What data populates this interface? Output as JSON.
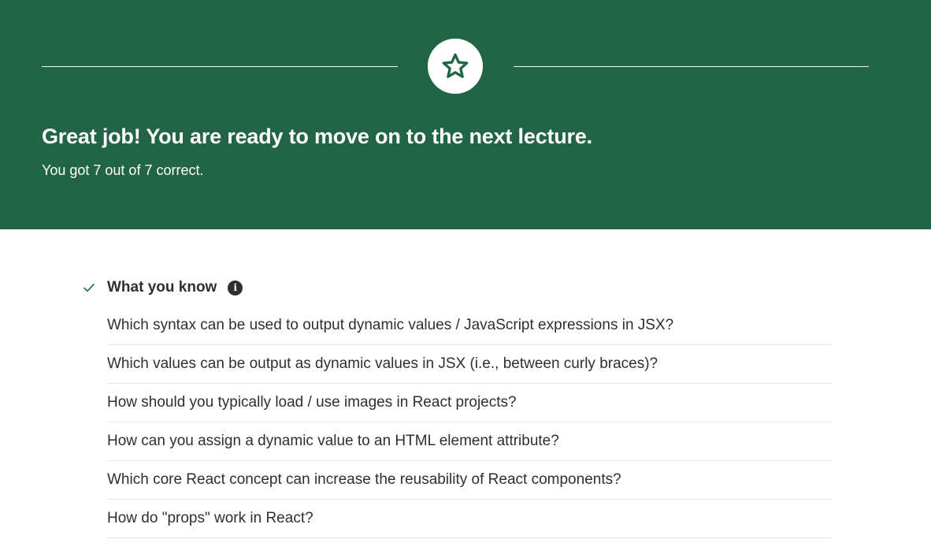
{
  "banner": {
    "background_color": "#226446",
    "badge_icon": "star-icon",
    "headline": "Great job! You are ready to move on to the next lecture.",
    "score_text": "You got 7 out of 7 correct."
  },
  "section": {
    "status_icon": "check-icon",
    "title": "What you know",
    "info_icon": "info-icon",
    "info_glyph": "i"
  },
  "questions": [
    {
      "text": "Which syntax can be used to output dynamic values / JavaScript expressions in JSX?"
    },
    {
      "text": "Which values can be output as dynamic values in JSX (i.e., between curly braces)?"
    },
    {
      "text": "How should you typically load / use images in React projects?"
    },
    {
      "text": "How can you assign a dynamic value to an HTML element attribute?"
    },
    {
      "text": "Which core React concept can increase the reusability of React components?"
    },
    {
      "text": "How do \"props\" work in React?"
    }
  ]
}
